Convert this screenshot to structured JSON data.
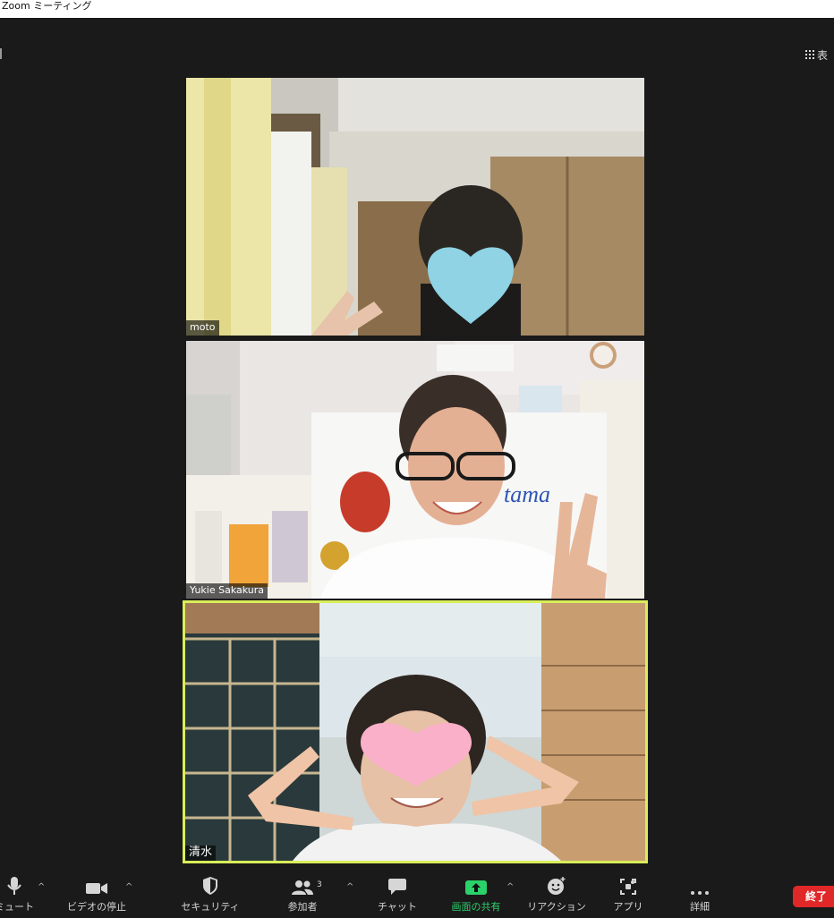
{
  "window": {
    "title": "Zoom ミーティング"
  },
  "view": {
    "label": "表"
  },
  "participants": [
    {
      "name": "moto"
    },
    {
      "name": "Yukie Sakakura"
    },
    {
      "name": "清水"
    }
  ],
  "toolbar": {
    "mute_label": "ミュート",
    "video_label": "ビデオの停止",
    "security_label": "セキュリティ",
    "participants_label": "参加者",
    "participants_count": "3",
    "chat_label": "チャット",
    "share_label": "画面の共有",
    "reactions_label": "リアクション",
    "apps_label": "アプリ",
    "more_label": "詳細",
    "end_label": "終了",
    "caret": "^"
  },
  "colors": {
    "background": "#1a1a1a",
    "active_speaker_border": "#d9ee5a",
    "share_green": "#2bd16a",
    "end_red": "#e02828",
    "heart_blue": "#8fd3e4",
    "heart_pink": "#f9b0c8"
  }
}
